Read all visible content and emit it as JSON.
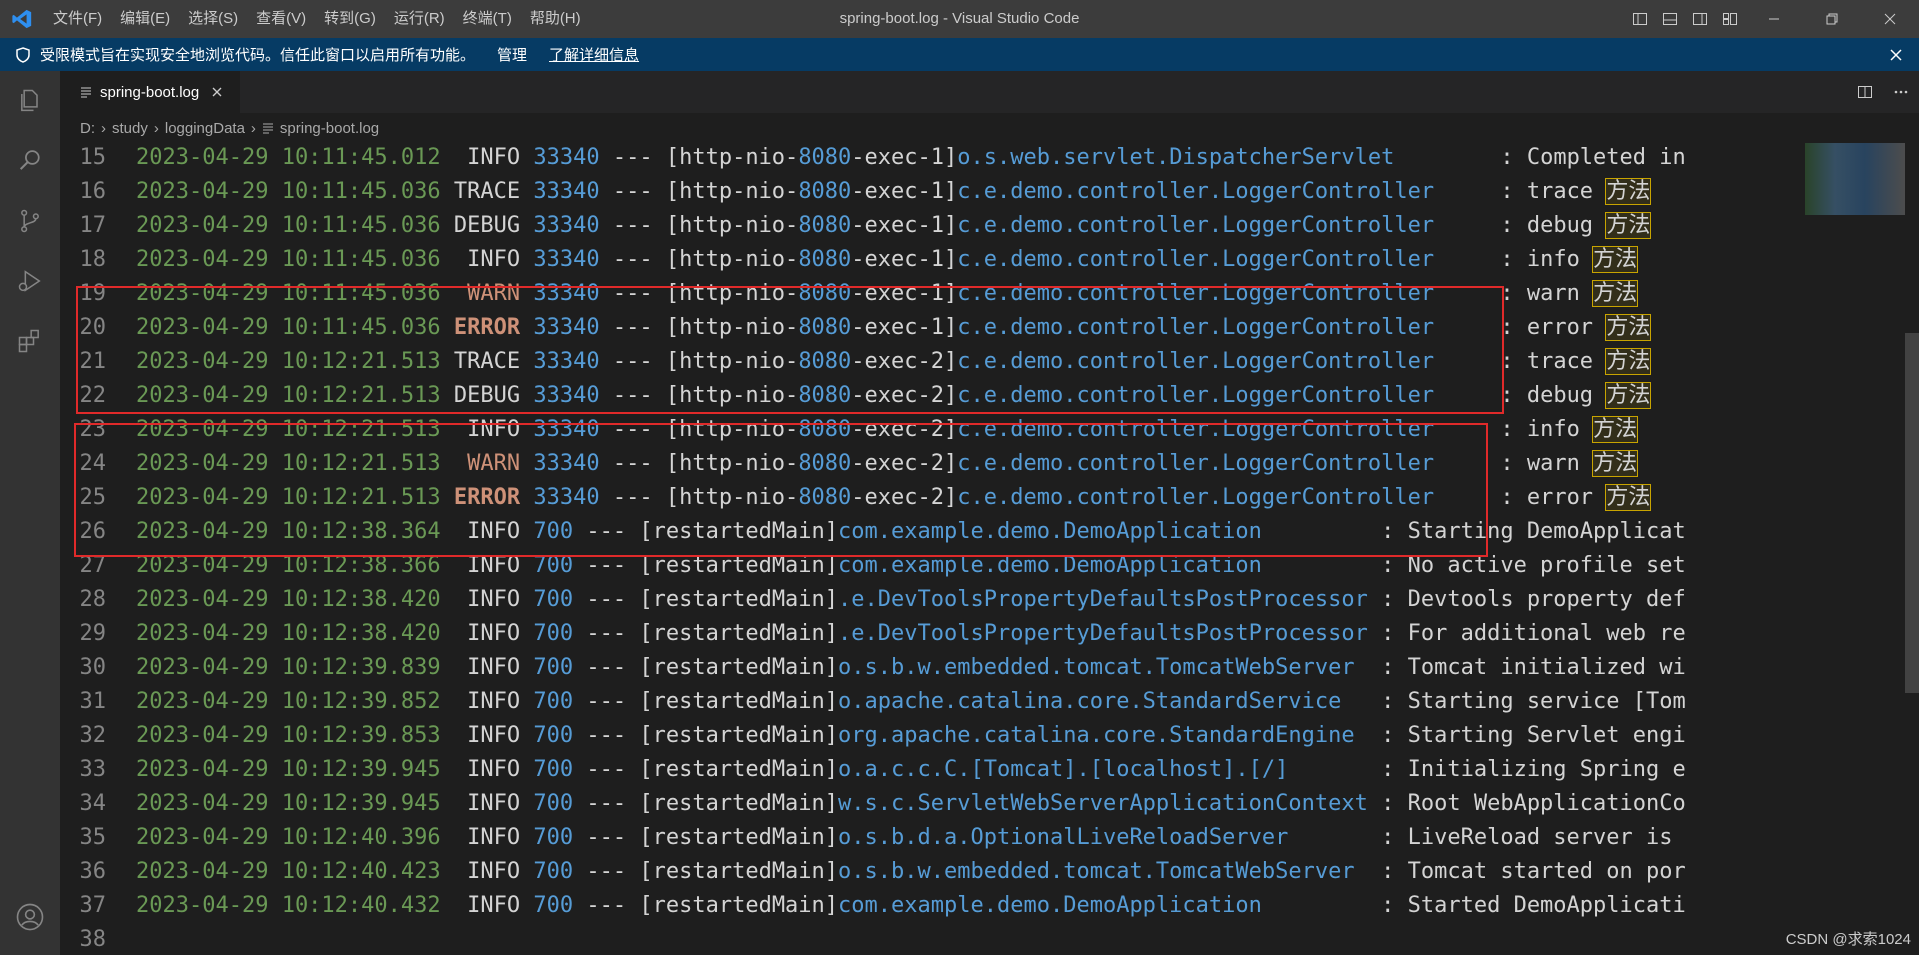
{
  "titlebar": {
    "menus": [
      "文件(F)",
      "编辑(E)",
      "选择(S)",
      "查看(V)",
      "转到(G)",
      "运行(R)",
      "终端(T)",
      "帮助(H)"
    ],
    "window_title": "spring-boot.log - Visual Studio Code"
  },
  "banner": {
    "text": "受限模式旨在实现安全地浏览代码。信任此窗口以启用所有功能。",
    "manage": "管理",
    "learn_more": "了解详细信息"
  },
  "tab": {
    "label": "spring-boot.log"
  },
  "breadcrumb": {
    "drive": "D:",
    "folder1": "study",
    "folder2": "loggingData",
    "file": "spring-boot.log"
  },
  "lines": [
    {
      "n": "15",
      "date": "2023-04-29 10:11:45.012",
      "level": " INFO",
      "pid": "33340",
      "sep": " --- [",
      "thread_a": "http-nio-",
      "thread_num": "8080",
      "thread_b": "-exec-1]",
      "logger": "o.s.web.servlet.DispatcherServlet       ",
      "colon": " : ",
      "msg": "Completed in",
      "cjk": ""
    },
    {
      "n": "16",
      "date": "2023-04-29 10:11:45.036",
      "level": "TRACE",
      "pid": "33340",
      "sep": " --- [",
      "thread_a": "http-nio-",
      "thread_num": "8080",
      "thread_b": "-exec-1]",
      "logger": "c.e.demo.controller.LoggerController    ",
      "colon": " : ",
      "msg": "trace ",
      "cjk": "方法"
    },
    {
      "n": "17",
      "date": "2023-04-29 10:11:45.036",
      "level": "DEBUG",
      "pid": "33340",
      "sep": " --- [",
      "thread_a": "http-nio-",
      "thread_num": "8080",
      "thread_b": "-exec-1]",
      "logger": "c.e.demo.controller.LoggerController    ",
      "colon": " : ",
      "msg": "debug ",
      "cjk": "方法"
    },
    {
      "n": "18",
      "date": "2023-04-29 10:11:45.036",
      "level": " INFO",
      "pid": "33340",
      "sep": " --- [",
      "thread_a": "http-nio-",
      "thread_num": "8080",
      "thread_b": "-exec-1]",
      "logger": "c.e.demo.controller.LoggerController    ",
      "colon": " : ",
      "msg": "info ",
      "cjk": "方法"
    },
    {
      "n": "19",
      "date": "2023-04-29 10:11:45.036",
      "level": " WARN",
      "pid": "33340",
      "sep": " --- [",
      "thread_a": "http-nio-",
      "thread_num": "8080",
      "thread_b": "-exec-1]",
      "logger": "c.e.demo.controller.LoggerController    ",
      "colon": " : ",
      "msg": "warn ",
      "cjk": "方法"
    },
    {
      "n": "20",
      "date": "2023-04-29 10:11:45.036",
      "level": "ERROR",
      "pid": "33340",
      "sep": " --- [",
      "thread_a": "http-nio-",
      "thread_num": "8080",
      "thread_b": "-exec-1]",
      "logger": "c.e.demo.controller.LoggerController    ",
      "colon": " : ",
      "msg": "error ",
      "cjk": "方法"
    },
    {
      "n": "21",
      "date": "2023-04-29 10:12:21.513",
      "level": "TRACE",
      "pid": "33340",
      "sep": " --- [",
      "thread_a": "http-nio-",
      "thread_num": "8080",
      "thread_b": "-exec-2]",
      "logger": "c.e.demo.controller.LoggerController    ",
      "colon": " : ",
      "msg": "trace ",
      "cjk": "方法"
    },
    {
      "n": "22",
      "date": "2023-04-29 10:12:21.513",
      "level": "DEBUG",
      "pid": "33340",
      "sep": " --- [",
      "thread_a": "http-nio-",
      "thread_num": "8080",
      "thread_b": "-exec-2]",
      "logger": "c.e.demo.controller.LoggerController    ",
      "colon": " : ",
      "msg": "debug ",
      "cjk": "方法"
    },
    {
      "n": "23",
      "date": "2023-04-29 10:12:21.513",
      "level": " INFO",
      "pid": "33340",
      "sep": " --- [",
      "thread_a": "http-nio-",
      "thread_num": "8080",
      "thread_b": "-exec-2]",
      "logger": "c.e.demo.controller.LoggerController    ",
      "colon": " : ",
      "msg": "info ",
      "cjk": "方法"
    },
    {
      "n": "24",
      "date": "2023-04-29 10:12:21.513",
      "level": " WARN",
      "pid": "33340",
      "sep": " --- [",
      "thread_a": "http-nio-",
      "thread_num": "8080",
      "thread_b": "-exec-2]",
      "logger": "c.e.demo.controller.LoggerController    ",
      "colon": " : ",
      "msg": "warn ",
      "cjk": "方法"
    },
    {
      "n": "25",
      "date": "2023-04-29 10:12:21.513",
      "level": "ERROR",
      "pid": "33340",
      "sep": " --- [",
      "thread_a": "http-nio-",
      "thread_num": "8080",
      "thread_b": "-exec-2]",
      "logger": "c.e.demo.controller.LoggerController    ",
      "colon": " : ",
      "msg": "error ",
      "cjk": "方法"
    },
    {
      "n": "26",
      "date": "2023-04-29 10:12:38.364",
      "level": " INFO",
      "pid": "700",
      "sep": " --- [",
      "thread_a": "restartedMain",
      "thread_num": "",
      "thread_b": "]",
      "logger": "com.example.demo.DemoApplication        ",
      "colon": " : ",
      "msg": "Starting DemoApplicat",
      "cjk": ""
    },
    {
      "n": "27",
      "date": "2023-04-29 10:12:38.366",
      "level": " INFO",
      "pid": "700",
      "sep": " --- [",
      "thread_a": "restartedMain",
      "thread_num": "",
      "thread_b": "]",
      "logger": "com.example.demo.DemoApplication        ",
      "colon": " : ",
      "msg": "No active profile set",
      "cjk": ""
    },
    {
      "n": "28",
      "date": "2023-04-29 10:12:38.420",
      "level": " INFO",
      "pid": "700",
      "sep": " --- [",
      "thread_a": "restartedMain",
      "thread_num": "",
      "thread_b": "]",
      "logger": ".e.DevToolsPropertyDefaultsPostProcessor",
      "colon": " : ",
      "msg": "Devtools property def",
      "cjk": ""
    },
    {
      "n": "29",
      "date": "2023-04-29 10:12:38.420",
      "level": " INFO",
      "pid": "700",
      "sep": " --- [",
      "thread_a": "restartedMain",
      "thread_num": "",
      "thread_b": "]",
      "logger": ".e.DevToolsPropertyDefaultsPostProcessor",
      "colon": " : ",
      "msg": "For additional web re",
      "cjk": ""
    },
    {
      "n": "30",
      "date": "2023-04-29 10:12:39.839",
      "level": " INFO",
      "pid": "700",
      "sep": " --- [",
      "thread_a": "restartedMain",
      "thread_num": "",
      "thread_b": "]",
      "logger": "o.s.b.w.embedded.tomcat.TomcatWebServer ",
      "colon": " : ",
      "msg": "Tomcat initialized wi",
      "cjk": ""
    },
    {
      "n": "31",
      "date": "2023-04-29 10:12:39.852",
      "level": " INFO",
      "pid": "700",
      "sep": " --- [",
      "thread_a": "restartedMain",
      "thread_num": "",
      "thread_b": "]",
      "logger": "o.apache.catalina.core.StandardService  ",
      "colon": " : ",
      "msg": "Starting service [Tom",
      "cjk": ""
    },
    {
      "n": "32",
      "date": "2023-04-29 10:12:39.853",
      "level": " INFO",
      "pid": "700",
      "sep": " --- [",
      "thread_a": "restartedMain",
      "thread_num": "",
      "thread_b": "]",
      "logger": "org.apache.catalina.core.StandardEngine ",
      "colon": " : ",
      "msg": "Starting Servlet engi",
      "cjk": ""
    },
    {
      "n": "33",
      "date": "2023-04-29 10:12:39.945",
      "level": " INFO",
      "pid": "700",
      "sep": " --- [",
      "thread_a": "restartedMain",
      "thread_num": "",
      "thread_b": "]",
      "logger": "o.a.c.c.C.[Tomcat].[localhost].[/]      ",
      "colon": " : ",
      "msg": "Initializing Spring e",
      "cjk": ""
    },
    {
      "n": "34",
      "date": "2023-04-29 10:12:39.945",
      "level": " INFO",
      "pid": "700",
      "sep": " --- [",
      "thread_a": "restartedMain",
      "thread_num": "",
      "thread_b": "]",
      "logger": "w.s.c.ServletWebServerApplicationContext",
      "colon": " : ",
      "msg": "Root WebApplicationCo",
      "cjk": ""
    },
    {
      "n": "35",
      "date": "2023-04-29 10:12:40.396",
      "level": " INFO",
      "pid": "700",
      "sep": " --- [",
      "thread_a": "restartedMain",
      "thread_num": "",
      "thread_b": "]",
      "logger": "o.s.b.d.a.OptionalLiveReloadServer      ",
      "colon": " : ",
      "msg": "LiveReload server is ",
      "cjk": ""
    },
    {
      "n": "36",
      "date": "2023-04-29 10:12:40.423",
      "level": " INFO",
      "pid": "700",
      "sep": " --- [",
      "thread_a": "restartedMain",
      "thread_num": "",
      "thread_b": "]",
      "logger": "o.s.b.w.embedded.tomcat.TomcatWebServer ",
      "colon": " : ",
      "msg": "Tomcat started on por",
      "cjk": ""
    },
    {
      "n": "37",
      "date": "2023-04-29 10:12:40.432",
      "level": " INFO",
      "pid": "700",
      "sep": " --- [",
      "thread_a": "restartedMain",
      "thread_num": "",
      "thread_b": "]",
      "logger": "com.example.demo.DemoApplication        ",
      "colon": " : ",
      "msg": "Started DemoApplicati",
      "cjk": ""
    },
    {
      "n": "38",
      "date": "",
      "level": "",
      "pid": "",
      "sep": "",
      "thread_a": "",
      "thread_num": "",
      "thread_b": "",
      "logger": "",
      "colon": "",
      "msg": "",
      "cjk": ""
    }
  ],
  "watermark": "CSDN @求索1024",
  "colors": {
    "titlebar": "#3c3c3c",
    "banner": "#063b64",
    "activitybar": "#333333",
    "editor": "#1e1e1e",
    "date": "#6a9955",
    "pid": "#569cd6",
    "warn_error": "#ce9178",
    "highlight_box": "#e02a2a"
  }
}
